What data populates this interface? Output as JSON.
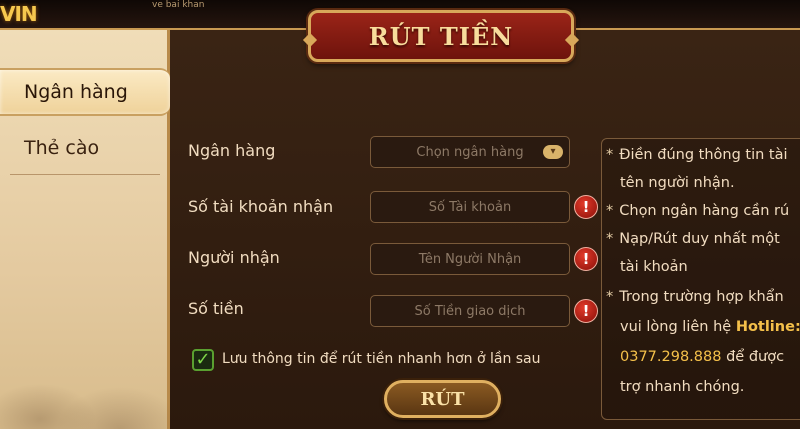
{
  "header": {
    "logo": "VIN",
    "top_text": "ve bai khan"
  },
  "title": "RÚT TIỀN",
  "sidebar": {
    "tabs": [
      {
        "label": "Ngân hàng",
        "active": true
      },
      {
        "label": "Thẻ cào",
        "active": false
      }
    ]
  },
  "form": {
    "bank": {
      "label": "Ngân hàng",
      "value": "Chọn ngân hàng"
    },
    "account": {
      "label": "Số tài khoản nhận",
      "placeholder": "Số Tài khoản"
    },
    "recipient": {
      "label": "Người nhận",
      "placeholder": "Tên Người Nhận"
    },
    "amount": {
      "label": "Số tiền",
      "placeholder": "Số Tiền giao dịch"
    },
    "warn_glyph": "!",
    "save_info": {
      "label": "Lưu thông tin để rút tiền nhanh hơn ở lần sau",
      "checked": true
    },
    "submit_label": "RÚT"
  },
  "info": {
    "star": "*",
    "lines": [
      "Điền đúng thông tin tài",
      "tên người nhận.",
      "Chọn ngân hàng cần rú",
      "Nạp/Rút duy nhất một",
      "tài khoản",
      "Trong trường hợp khẩn",
      "vui lòng liên hệ",
      "để được",
      "trợ nhanh chóng."
    ],
    "hotline_label": "Hotline:",
    "hotline_number": "0377.298.888"
  },
  "colors": {
    "accent_gold": "#f4c04a",
    "title_red": "#9a2418",
    "warn_red": "#e23a2a",
    "check_green": "#7ed648"
  },
  "icons": {
    "dropdown": "bank-dropdown-icon",
    "warning": "warning-icon",
    "check": "checkmark-icon"
  }
}
